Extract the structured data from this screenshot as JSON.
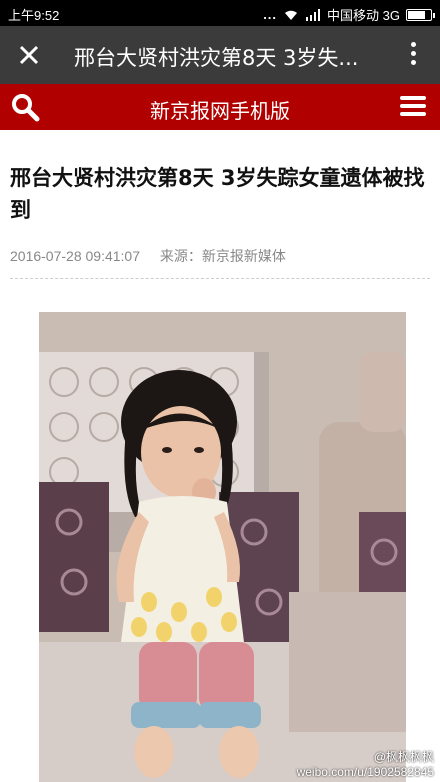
{
  "status_bar": {
    "time": "上午9:52",
    "dots": "...",
    "carrier": "中国移动 3G"
  },
  "app_bar": {
    "title": "邢台大贤村洪灾第8天 3岁失...",
    "close_icon": "close-icon",
    "more_icon": "more-vertical-icon"
  },
  "site_header": {
    "title": "新京报网手机版",
    "search_icon": "search-icon",
    "menu_icon": "hamburger-menu-icon",
    "color": "#b10000"
  },
  "article": {
    "headline": "邢台大贤村洪灾第8天 3岁失踪女童遗体被找到",
    "date": "2016-07-28 09:41:07",
    "source": "来源：新京报新媒体"
  },
  "photo": {
    "description_icon": "photo-of-girl"
  },
  "watermark": {
    "handle": "@枫枫枫枫",
    "url": "weibo.com/u/1902582845"
  }
}
